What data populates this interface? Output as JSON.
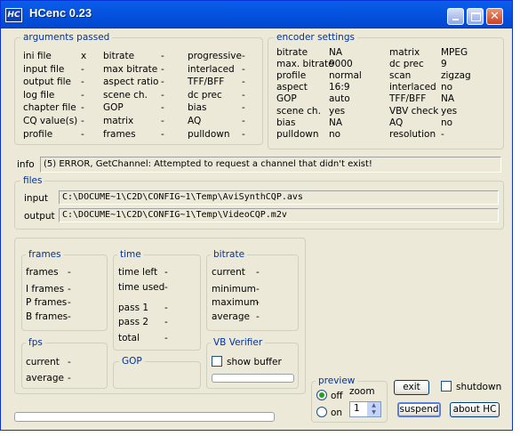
{
  "window": {
    "title": "HCenc 0.23",
    "icon_text": "HC"
  },
  "arguments": {
    "legend": "arguments passed",
    "col1": [
      {
        "label": "ini file",
        "value": "x"
      },
      {
        "label": "input file",
        "value": "-"
      },
      {
        "label": "output file",
        "value": "-"
      },
      {
        "label": "log file",
        "value": "-"
      },
      {
        "label": "chapter file",
        "value": "-"
      },
      {
        "label": "CQ value(s)",
        "value": "-"
      },
      {
        "label": "profile",
        "value": "-"
      }
    ],
    "col2": [
      {
        "label": "bitrate",
        "value": "-"
      },
      {
        "label": "max bitrate",
        "value": "-"
      },
      {
        "label": "aspect ratio",
        "value": "-"
      },
      {
        "label": "scene ch.",
        "value": "-"
      },
      {
        "label": "GOP",
        "value": "-"
      },
      {
        "label": "matrix",
        "value": "-"
      },
      {
        "label": "frames",
        "value": "-"
      }
    ],
    "col3": [
      {
        "label": "progressive",
        "value": "-"
      },
      {
        "label": "interlaced",
        "value": "-"
      },
      {
        "label": "TFF/BFF",
        "value": "-"
      },
      {
        "label": "dc prec",
        "value": "-"
      },
      {
        "label": "bias",
        "value": "-"
      },
      {
        "label": "AQ",
        "value": "-"
      },
      {
        "label": "pulldown",
        "value": "-"
      }
    ]
  },
  "encoder": {
    "legend": "encoder settings",
    "col1": [
      {
        "label": "bitrate",
        "value": "NA"
      },
      {
        "label": "max. bitrate",
        "value": "9000"
      },
      {
        "label": "profile",
        "value": "normal"
      },
      {
        "label": "aspect",
        "value": "16:9"
      },
      {
        "label": "GOP",
        "value": "auto"
      },
      {
        "label": "scene ch.",
        "value": "yes"
      },
      {
        "label": "bias",
        "value": "NA"
      },
      {
        "label": "pulldown",
        "value": "no"
      }
    ],
    "col2": [
      {
        "label": "matrix",
        "value": "MPEG"
      },
      {
        "label": "dc prec",
        "value": "9"
      },
      {
        "label": "scan",
        "value": "zigzag"
      },
      {
        "label": "interlaced",
        "value": "no"
      },
      {
        "label": "TFF/BFF",
        "value": "NA"
      },
      {
        "label": "VBV check",
        "value": "yes"
      },
      {
        "label": "AQ",
        "value": "no"
      },
      {
        "label": "resolution",
        "value": "-"
      }
    ]
  },
  "info": {
    "label": "info",
    "message": "(5) ERROR, GetChannel: Attempted to request a channel that didn't exist!"
  },
  "files": {
    "legend": "files",
    "input_label": "input",
    "input_value": "C:\\DOCUME~1\\C2D\\CONFIG~1\\Temp\\AviSynthCQP.avs",
    "output_label": "output",
    "output_value": "C:\\DOCUME~1\\C2D\\CONFIG~1\\Temp\\VideoCQP.m2v"
  },
  "frames": {
    "legend": "frames",
    "rows": [
      {
        "label": "frames",
        "value": "-"
      },
      {
        "label": "I frames",
        "value": "-"
      },
      {
        "label": "P frames",
        "value": "-"
      },
      {
        "label": "B frames",
        "value": "-"
      }
    ]
  },
  "time": {
    "legend": "time",
    "rows": [
      {
        "label": "time left",
        "value": "-"
      },
      {
        "label": "time used",
        "value": "-"
      },
      {
        "label": "pass 1",
        "value": "-"
      },
      {
        "label": "pass 2",
        "value": "-"
      },
      {
        "label": "total",
        "value": "-"
      }
    ]
  },
  "bitrate_stats": {
    "legend": "bitrate",
    "rows": [
      {
        "label": "current",
        "value": "-"
      },
      {
        "label": "minimum",
        "value": "-"
      },
      {
        "label": "maximum",
        "value": "-"
      },
      {
        "label": "average",
        "value": "-"
      }
    ]
  },
  "fps": {
    "legend": "fps",
    "rows": [
      {
        "label": "current",
        "value": "-"
      },
      {
        "label": "average",
        "value": "-"
      }
    ]
  },
  "gop": {
    "legend": "GOP"
  },
  "vbv": {
    "legend": "VB Verifier",
    "show_buffer_label": "show buffer",
    "buffer_level": 0
  },
  "preview": {
    "legend": "preview",
    "off_label": "off",
    "on_label": "on",
    "zoom_label": "zoom",
    "zoom_value": "1",
    "selected": "off"
  },
  "buttons": {
    "exit": "exit",
    "suspend": "suspend",
    "about": "about  HC",
    "shutdown": "shutdown"
  },
  "progress": {
    "value": 0
  },
  "colors": {
    "legend": "#003399",
    "title_bar": "#0553e0",
    "window_bg": "#ece9d8"
  }
}
